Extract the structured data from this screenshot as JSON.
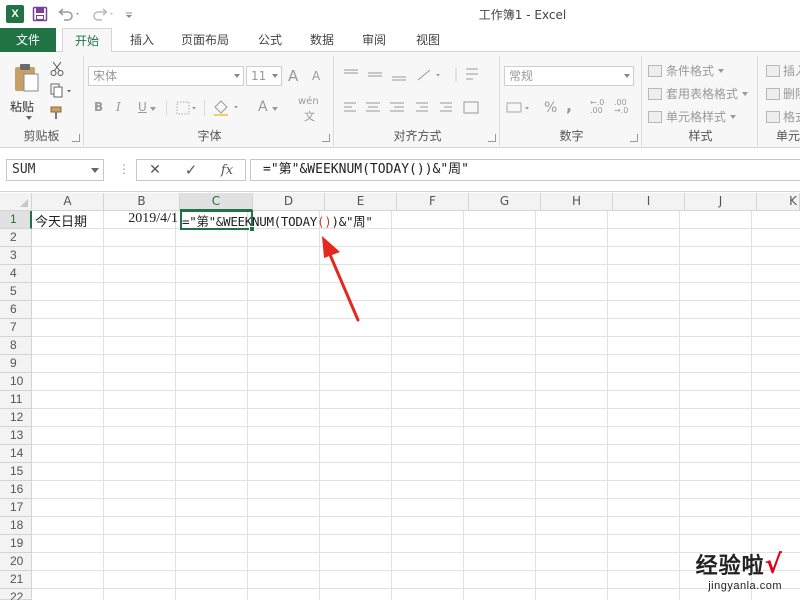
{
  "window": {
    "title": "工作簿1 - Excel",
    "app_icon": "X"
  },
  "quick_access": [
    "save-icon",
    "undo-icon",
    "redo-icon",
    "customize-icon"
  ],
  "tabs": [
    {
      "label": "文件"
    },
    {
      "label": "开始"
    },
    {
      "label": "插入"
    },
    {
      "label": "页面布局"
    },
    {
      "label": "公式"
    },
    {
      "label": "数据"
    },
    {
      "label": "审阅"
    },
    {
      "label": "视图"
    }
  ],
  "ribbon": {
    "clipboard": {
      "paste_label": "粘贴",
      "group_label": "剪贴板"
    },
    "font": {
      "font_name": "宋体",
      "font_size": "11",
      "group_label": "字体",
      "bold": "B",
      "italic": "I",
      "underline": "U",
      "grow": "A",
      "shrink": "A",
      "font_color": "A",
      "phonetic": "wén"
    },
    "alignment": {
      "group_label": "对齐方式"
    },
    "number": {
      "format": "常规",
      "group_label": "数字",
      "percent": "%",
      "comma": ","
    },
    "styles": {
      "conditional": "条件格式",
      "table": "套用表格格式",
      "cell": "单元格样式",
      "group_label": "样式"
    },
    "cells": {
      "insert": "插入",
      "delete": "删除",
      "format": "格式",
      "group_label": "单元"
    }
  },
  "formula_bar": {
    "name_box": "SUM",
    "separator": "⋮",
    "cancel": "✕",
    "enter": "✓",
    "fx": "fx",
    "formula": "=\"第\"&WEEKNUM(TODAY())&\"周\""
  },
  "sheet": {
    "columns": [
      "A",
      "B",
      "C",
      "D",
      "E",
      "F",
      "G",
      "H",
      "I",
      "J",
      "K"
    ],
    "rows": [
      "1",
      "2",
      "3",
      "4",
      "5",
      "6",
      "7",
      "8",
      "9",
      "10",
      "11",
      "12",
      "13",
      "14",
      "15",
      "16",
      "17",
      "18",
      "19",
      "20",
      "21",
      "22"
    ],
    "cells": {
      "A1": "今天日期",
      "B1": "2019/4/1",
      "C1_prefix": "=\"第\"&WEEKNUM(TODAY",
      "C1_paren": "()",
      "C1_suffix": ")&\"周\""
    },
    "active_cell": "C1"
  },
  "watermark": {
    "main": "经验啦",
    "check": "√",
    "sub": "jingyanla.com"
  },
  "colors": {
    "accent": "#217346",
    "arrow": "#e3281f"
  }
}
